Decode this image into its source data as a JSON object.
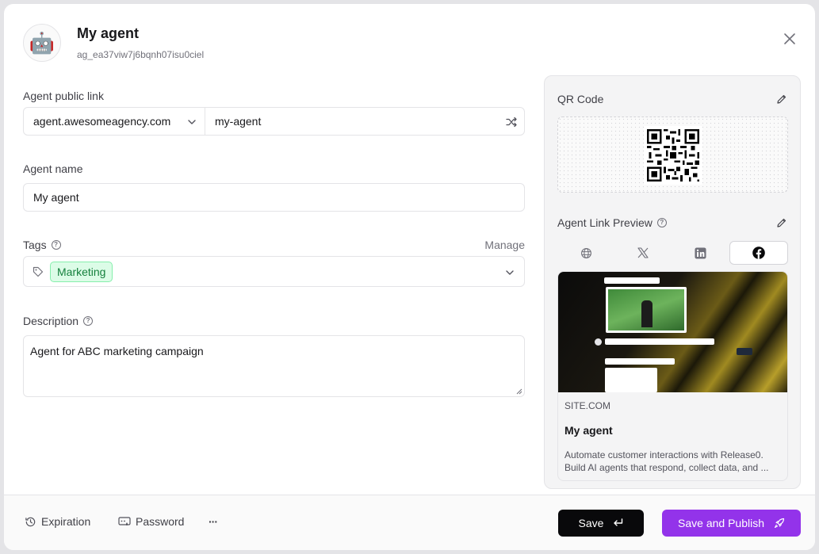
{
  "header": {
    "title": "My agent",
    "agent_id": "ag_ea37viw7j6bqnh07isu0ciel"
  },
  "public_link": {
    "label": "Agent public link",
    "domain": "agent.awesomeagency.com",
    "slug": "my-agent"
  },
  "agent_name": {
    "label": "Agent name",
    "value": "My agent"
  },
  "tags": {
    "label": "Tags",
    "manage_label": "Manage",
    "selected": [
      "Marketing"
    ]
  },
  "description": {
    "label": "Description",
    "value": "Agent for ABC marketing campaign"
  },
  "qr_panel": {
    "title": "QR Code"
  },
  "link_preview": {
    "title": "Agent Link Preview",
    "tabs": [
      "website",
      "x",
      "linkedin",
      "facebook"
    ],
    "active_tab": "facebook",
    "site": "SITE.COM",
    "card_title": "My agent",
    "card_description": "Automate customer interactions with Release0. Build AI agents that respond, collect data, and ..."
  },
  "footer": {
    "expiration_label": "Expiration",
    "password_label": "Password",
    "more_label": "···",
    "save_label": "Save",
    "publish_label": "Save and Publish"
  },
  "colors": {
    "primary": "#9333ea",
    "tag_bg": "#dcfce7",
    "tag_text": "#15803d",
    "save_bg": "#09090b"
  }
}
